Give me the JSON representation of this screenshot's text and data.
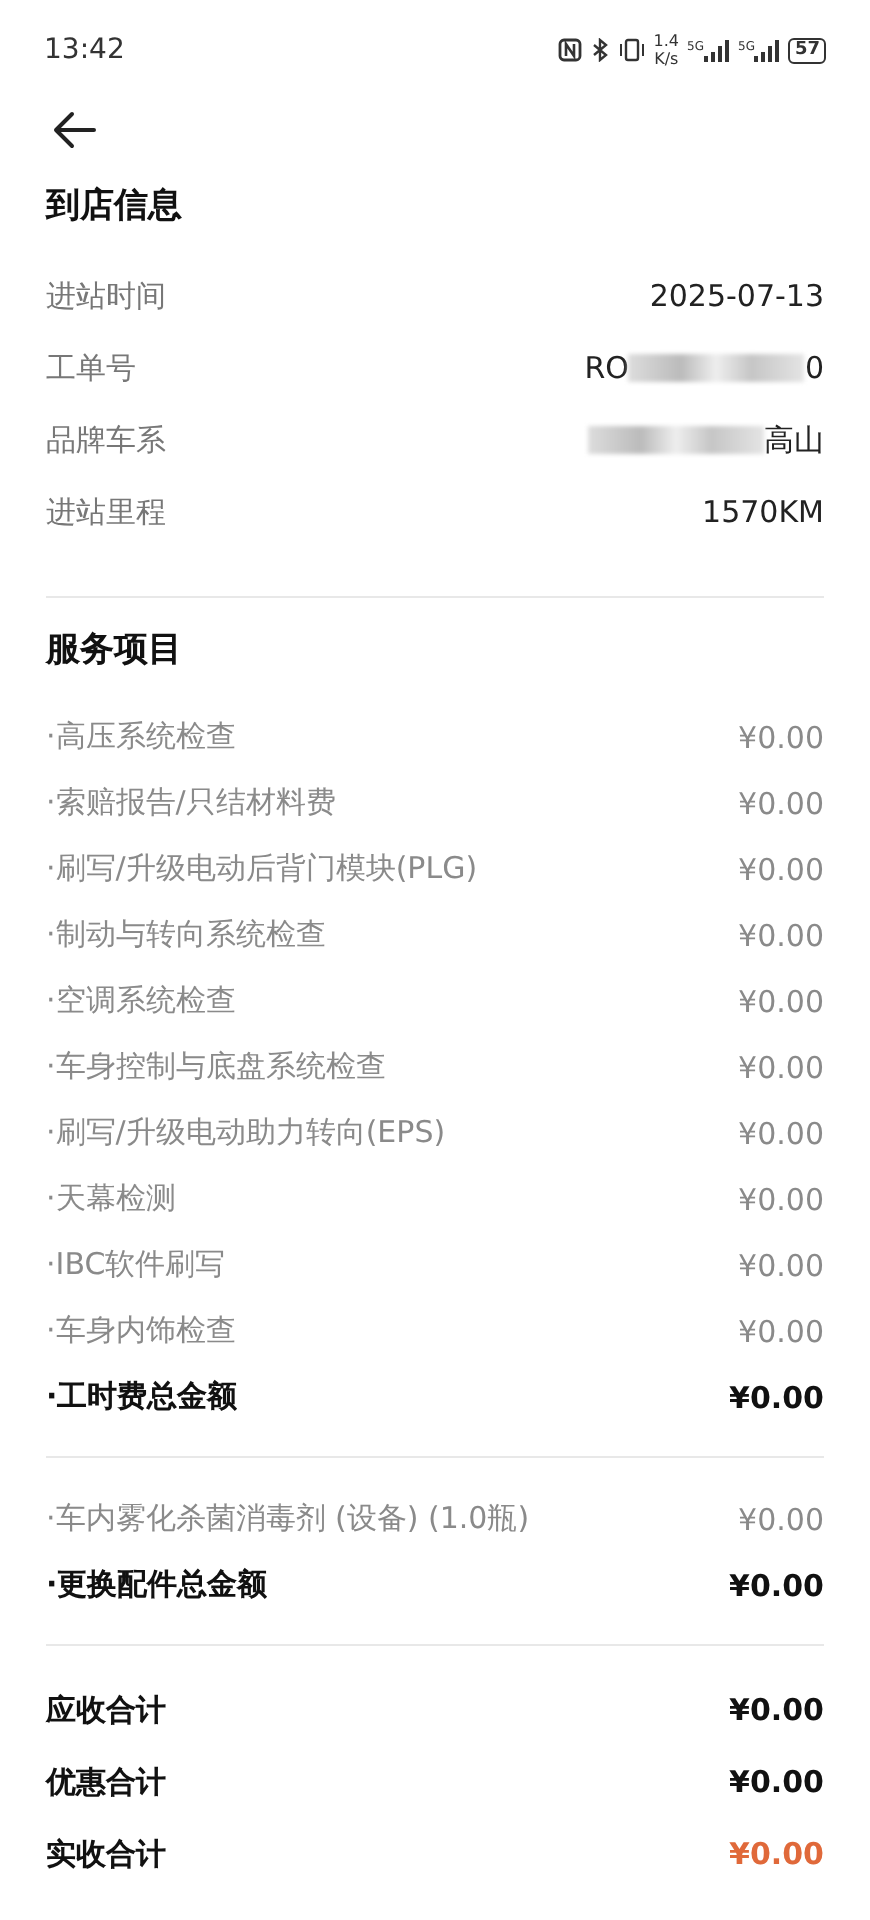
{
  "status_bar": {
    "time": "13:42",
    "speed": "1.4",
    "speed_unit": "K/s",
    "network_1": "5G",
    "network_2": "5G",
    "battery": "57"
  },
  "arrival": {
    "title": "到店信息",
    "rows": [
      {
        "label": "进站时间",
        "value": "2025-07-13",
        "redacted": false
      },
      {
        "label": "工单号",
        "value": "RO",
        "value_end": "0",
        "redacted": true
      },
      {
        "label": "品牌车系",
        "value": "",
        "value_end": "高山",
        "redacted": true
      },
      {
        "label": "进站里程",
        "value": "1570KM",
        "redacted": false
      }
    ]
  },
  "services": {
    "title": "服务项目",
    "groups": [
      {
        "items": [
          {
            "kind": "item",
            "name": "·高压系统检查",
            "amount": "¥0.00"
          },
          {
            "kind": "item",
            "name": "·索赔报告/只结材料费",
            "amount": "¥0.00"
          },
          {
            "kind": "item",
            "name": "·刷写/升级电动后背门模块(PLG)",
            "amount": "¥0.00"
          },
          {
            "kind": "item",
            "name": "·制动与转向系统检查",
            "amount": "¥0.00"
          },
          {
            "kind": "item",
            "name": "·空调系统检查",
            "amount": "¥0.00"
          },
          {
            "kind": "item",
            "name": "·车身控制与底盘系统检查",
            "amount": "¥0.00"
          },
          {
            "kind": "item",
            "name": "·刷写/升级电动助力转向(EPS)",
            "amount": "¥0.00"
          },
          {
            "kind": "item",
            "name": "·天幕检测",
            "amount": "¥0.00"
          },
          {
            "kind": "item",
            "name": "·IBC软件刷写",
            "amount": "¥0.00"
          },
          {
            "kind": "item",
            "name": "·车身内饰检查",
            "amount": "¥0.00"
          },
          {
            "kind": "total",
            "name": "·工时费总金额",
            "amount": "¥0.00"
          }
        ]
      },
      {
        "items": [
          {
            "kind": "item",
            "name": "·车内雾化杀菌消毒剂 (设备) (1.0瓶)",
            "amount": "¥0.00"
          },
          {
            "kind": "total",
            "name": "·更换配件总金额",
            "amount": "¥0.00"
          }
        ]
      }
    ]
  },
  "summary": [
    {
      "label": "应收合计",
      "amount": "¥0.00",
      "highlight": false
    },
    {
      "label": "优惠合计",
      "amount": "¥0.00",
      "highlight": false
    },
    {
      "label": "实收合计",
      "amount": "¥0.00",
      "highlight": true
    }
  ]
}
